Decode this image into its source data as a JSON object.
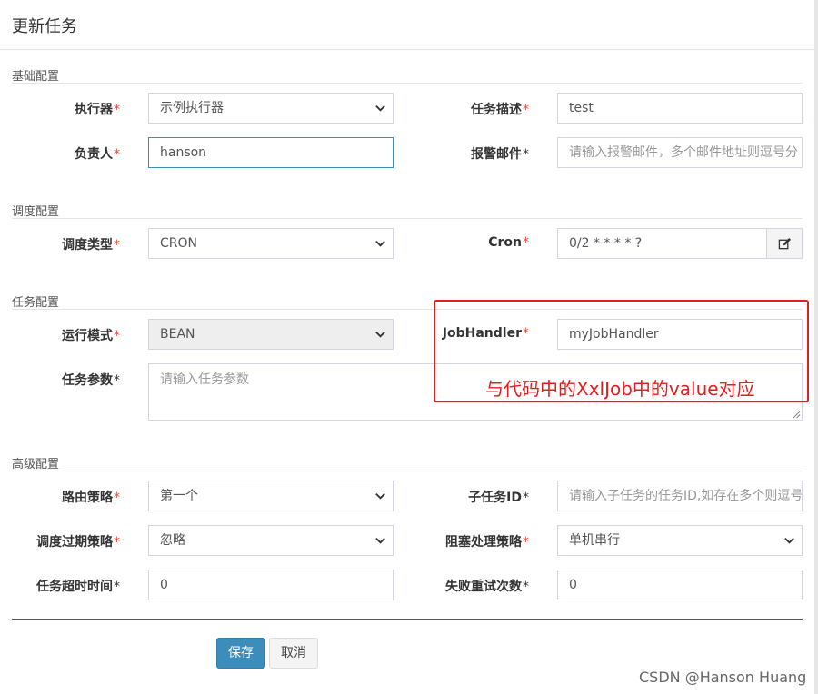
{
  "dialog": {
    "title": "更新任务"
  },
  "sections": {
    "basic": "基础配置",
    "schedule": "调度配置",
    "task": "任务配置",
    "advanced": "高级配置"
  },
  "required_mark": "*",
  "fields": {
    "executor": {
      "label": "执行器",
      "value": "示例执行器"
    },
    "job_desc": {
      "label": "任务描述",
      "value": "test"
    },
    "author": {
      "label": "负责人",
      "value": "hanson"
    },
    "alarm_email": {
      "label": "报警邮件",
      "placeholder": "请输入报警邮件，多个邮件地址则逗号分"
    },
    "schedule_type": {
      "label": "调度类型",
      "value": "CRON"
    },
    "cron": {
      "label": "Cron",
      "value": "0/2 * * * * ?"
    },
    "glue_type": {
      "label": "运行模式",
      "value": "BEAN"
    },
    "job_handler": {
      "label": "JobHandler",
      "value": "myJobHandler"
    },
    "job_param": {
      "label": "任务参数",
      "placeholder": "请输入任务参数"
    },
    "route_strategy": {
      "label": "路由策略",
      "value": "第一个"
    },
    "child_job_id": {
      "label": "子任务ID",
      "placeholder": "请输入子任务的任务ID,如存在多个则逗号"
    },
    "misfire_strategy": {
      "label": "调度过期策略",
      "value": "忽略"
    },
    "block_strategy": {
      "label": "阻塞处理策略",
      "value": "单机串行"
    },
    "timeout": {
      "label": "任务超时时间",
      "value": "0"
    },
    "fail_retry": {
      "label": "失败重试次数",
      "value": "0"
    }
  },
  "annotation": {
    "text": "与代码中的XxlJob中的value对应",
    "color": "#e02020"
  },
  "buttons": {
    "save": "保存",
    "cancel": "取消"
  },
  "watermark": "CSDN @Hanson Huang",
  "colors": {
    "primary": "#3c8dbc",
    "required": "#dd4b39"
  },
  "icons": {
    "cron_edit": "edit-icon",
    "select": "chevron-down-icon"
  }
}
